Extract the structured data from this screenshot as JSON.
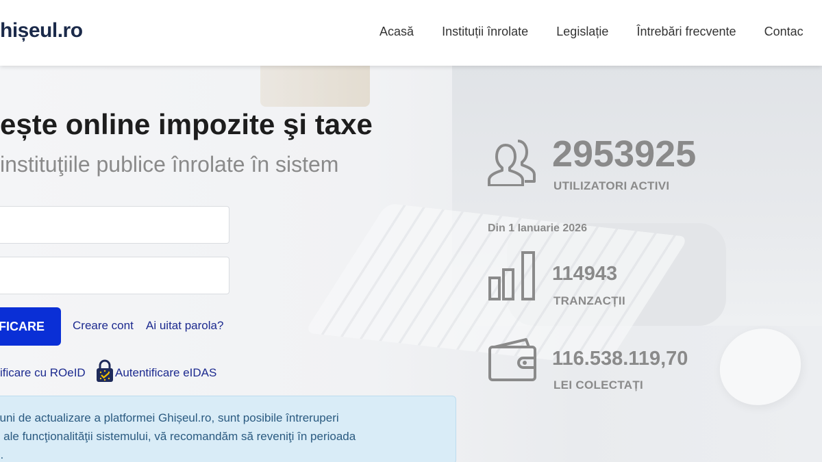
{
  "header": {
    "logo": "hișeul.ro",
    "nav": [
      "Acasă",
      "Instituții înrolate",
      "Legislație",
      "Întrebări frecvente",
      "Contac"
    ]
  },
  "hero": {
    "headline": "ește online impozite şi taxe",
    "subline": "instituţiile publice înrolate în sistem"
  },
  "login": {
    "button_label": "IFICARE",
    "create_account": "Creare cont",
    "forgot_password": "Ai uitat parola?",
    "roeid": "ificare cu ROeID",
    "eidas": "Autentificare eIDAS"
  },
  "notice": {
    "line1": "ţiuni de actualizare a platformei Ghișeul.ro, sunt posibile întreruperi",
    "line2": "e ale funcţionalităţii sistemului, vă recomandăm să reveniţi în perioada",
    "line3": "e."
  },
  "stats": {
    "users": {
      "value": "2953925",
      "label": "UTILIZATORI ACTIVI",
      "icon": "users-icon"
    },
    "since": "Din 1 Ianuarie 2026",
    "transactions": {
      "value": "114943",
      "label": "TRANZACȚII",
      "icon": "bar-chart-icon"
    },
    "collected": {
      "value": "116.538.119,70",
      "label": "LEI COLECTAȚI",
      "icon": "wallet-icon"
    }
  },
  "colors": {
    "primary_button": "#0a2fd6",
    "link": "#1c2a8f",
    "notice_bg": "#d9ecf7",
    "stat_gray": "#8a8a8a"
  }
}
